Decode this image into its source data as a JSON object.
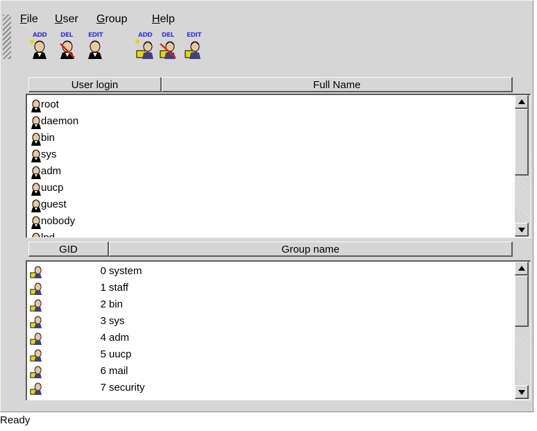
{
  "menubar": {
    "items": [
      {
        "mnemonic": "F",
        "rest": "ile"
      },
      {
        "mnemonic": "U",
        "rest": "ser"
      },
      {
        "mnemonic": "G",
        "rest": "roup"
      },
      {
        "mnemonic": "H",
        "rest": "elp"
      }
    ]
  },
  "toolbar": {
    "buttons": [
      {
        "label": "ADD",
        "icon": "user-add-icon"
      },
      {
        "label": "DEL",
        "icon": "user-delete-icon"
      },
      {
        "label": "EDIT",
        "icon": "user-edit-icon"
      },
      {
        "label": "ADD",
        "icon": "group-add-icon"
      },
      {
        "label": "DEL",
        "icon": "group-delete-icon"
      },
      {
        "label": "EDIT",
        "icon": "group-edit-icon"
      }
    ]
  },
  "users": {
    "columns": [
      "User login",
      "Full Name"
    ],
    "rows": [
      {
        "login": "root",
        "full_name": ""
      },
      {
        "login": "daemon",
        "full_name": ""
      },
      {
        "login": "bin",
        "full_name": ""
      },
      {
        "login": "sys",
        "full_name": ""
      },
      {
        "login": "adm",
        "full_name": ""
      },
      {
        "login": "uucp",
        "full_name": ""
      },
      {
        "login": "guest",
        "full_name": ""
      },
      {
        "login": "nobody",
        "full_name": ""
      },
      {
        "login": "lpd",
        "full_name": ""
      }
    ]
  },
  "groups": {
    "columns": [
      "GID",
      "Group name"
    ],
    "rows": [
      {
        "gid": "0",
        "name": "system"
      },
      {
        "gid": "1",
        "name": "staff"
      },
      {
        "gid": "2",
        "name": "bin"
      },
      {
        "gid": "3",
        "name": "sys"
      },
      {
        "gid": "4",
        "name": "adm"
      },
      {
        "gid": "5",
        "name": "uucp"
      },
      {
        "gid": "6",
        "name": "mail"
      },
      {
        "gid": "7",
        "name": "security"
      }
    ]
  },
  "status": {
    "text": "Ready"
  },
  "colors": {
    "window_bg": "#d6d6d6",
    "list_bg": "#ffffff",
    "toolbar_label": "#3b3bd8",
    "group_icon": "#e8d800"
  }
}
